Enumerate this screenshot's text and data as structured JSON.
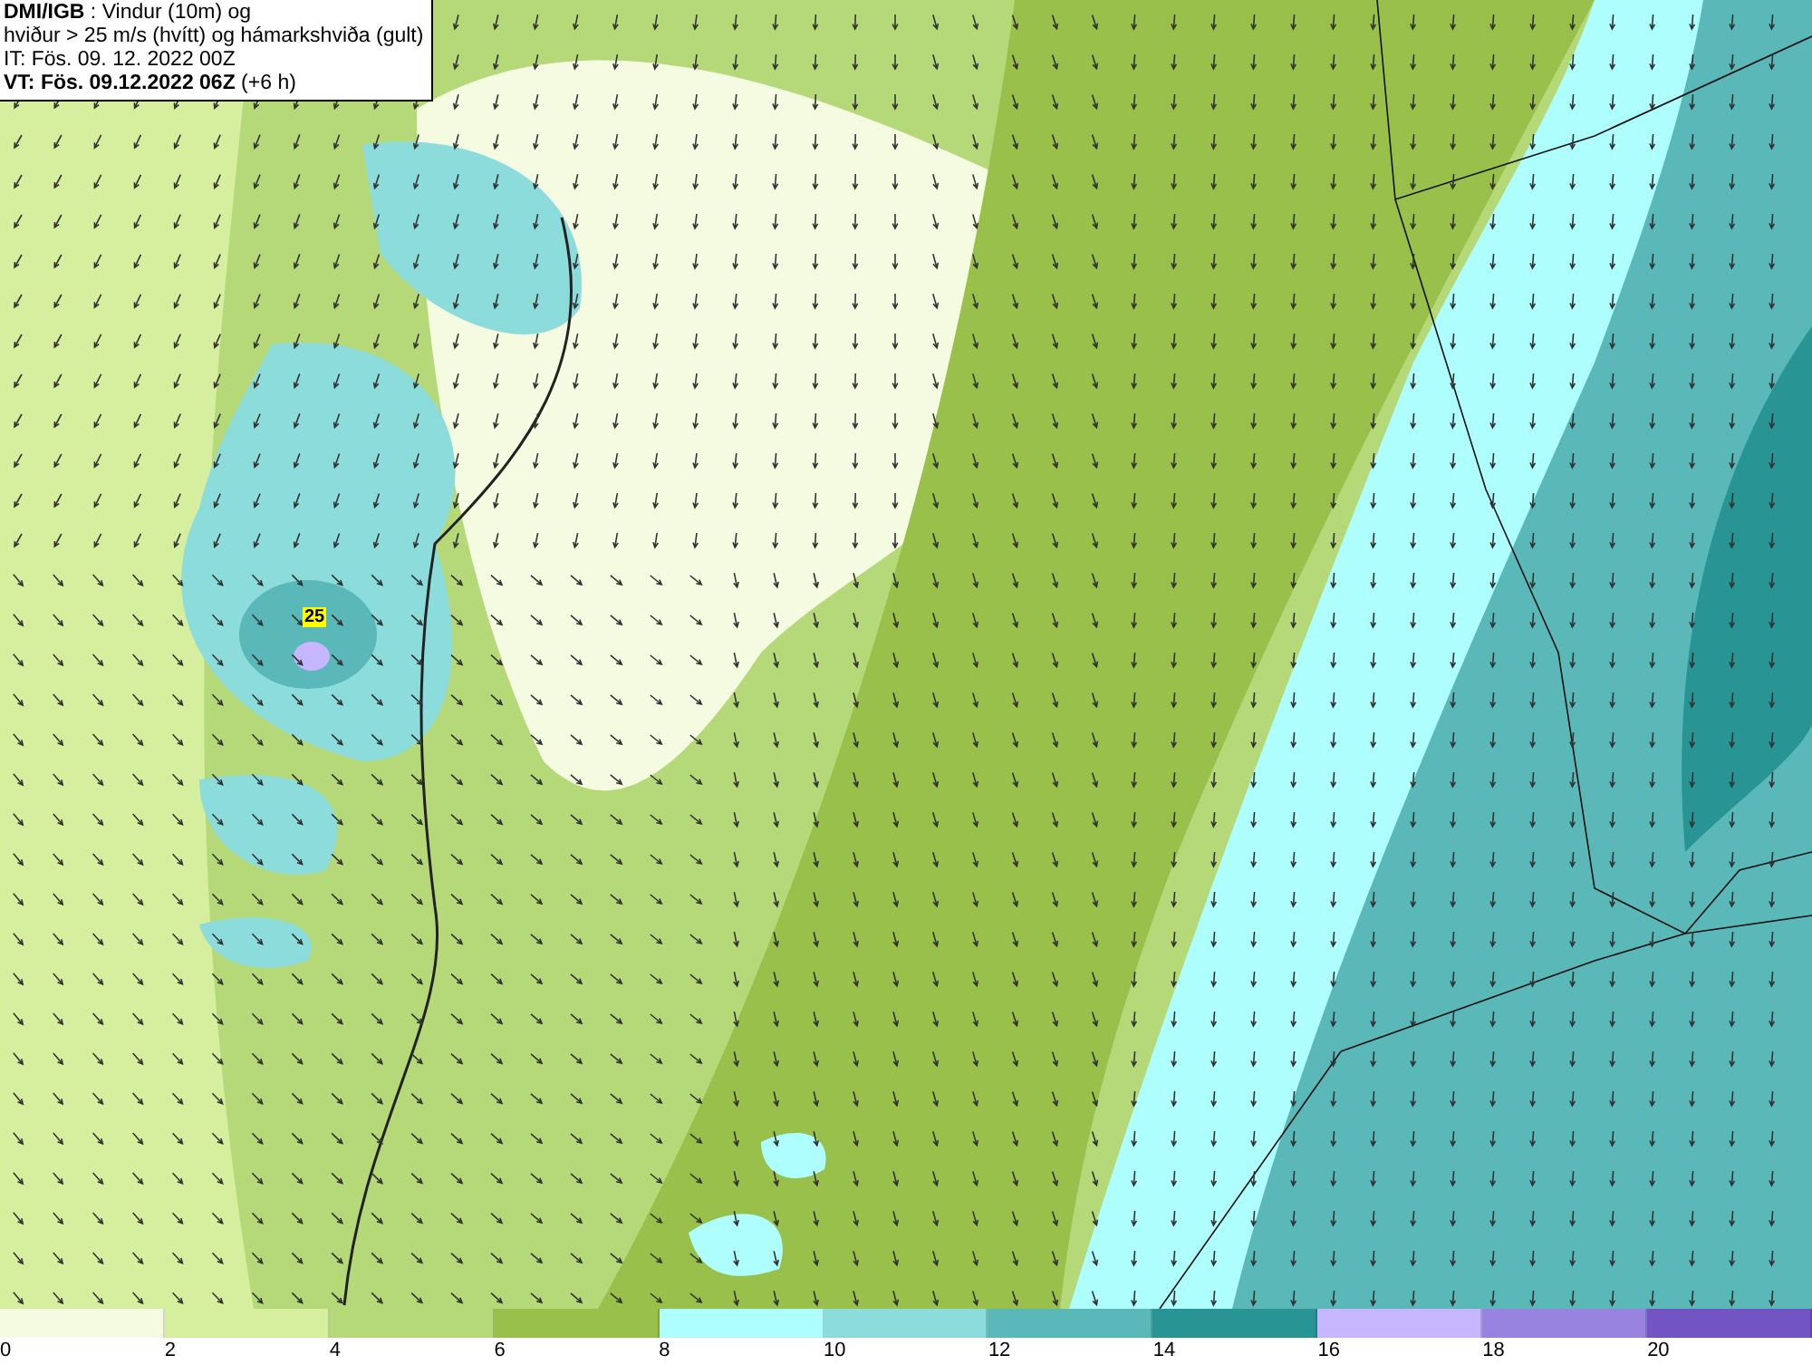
{
  "title_box": {
    "lines": [
      "**DMI/IGB** : Vindur (10m) og",
      "hviður > 25 m/s (hvítt) og hámarkshviða (gult)",
      "IT: Fös. 09. 12. 2022 00Z",
      "**VT: Fös. 09.12.2022 06Z** (+6 h)"
    ]
  },
  "map": {
    "gust_labels": [
      "25"
    ]
  },
  "legend": [
    {
      "label": "0",
      "color": "#f4fbe1"
    },
    {
      "label": "2",
      "color": "#d6ef9e"
    },
    {
      "label": "4",
      "color": "#b5d978"
    },
    {
      "label": "6",
      "color": "#98c04a"
    },
    {
      "label": "8",
      "color": "#aefefe"
    },
    {
      "label": "10",
      "color": "#8cdcdc"
    },
    {
      "label": "12",
      "color": "#5ab8b8"
    },
    {
      "label": "14",
      "color": "#289494"
    },
    {
      "label": "16",
      "color": "#c6b6fe"
    },
    {
      "label": "18",
      "color": "#9884e0"
    },
    {
      "label": "20",
      "color": "#7254c4"
    }
  ]
}
